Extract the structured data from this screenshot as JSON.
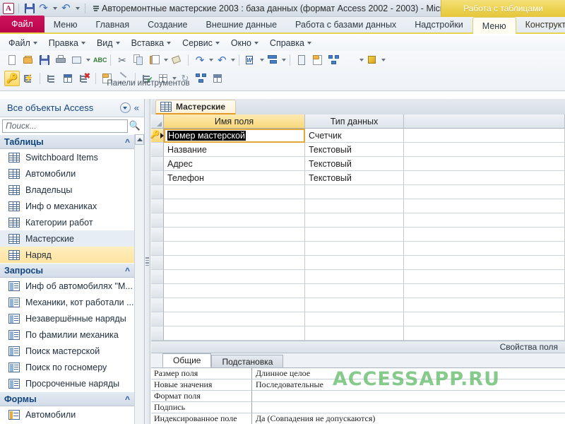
{
  "window": {
    "title": "Авторемонтные мастерские 2003 : база данных (формат Access 2002 - 2003)  -  Microsof...",
    "contextual_banner": "Работа с таблицами"
  },
  "quick_access": {
    "app_icon": "access-logo-icon",
    "buttons": [
      {
        "name": "save-icon",
        "label": "Сохранить"
      },
      {
        "name": "undo-icon",
        "label": "Отменить"
      },
      {
        "name": "redo-icon",
        "label": "Вернуть"
      },
      {
        "name": "customize-qat-icon",
        "label": "Настройка панели быстрого доступа"
      }
    ]
  },
  "ribbon": {
    "tabs": [
      {
        "label": "Файл",
        "kind": "file"
      },
      {
        "label": "Меню",
        "kind": "normal"
      },
      {
        "label": "Главная",
        "kind": "normal"
      },
      {
        "label": "Создание",
        "kind": "normal"
      },
      {
        "label": "Внешние данные",
        "kind": "normal"
      },
      {
        "label": "Работа с базами данных",
        "kind": "normal"
      },
      {
        "label": "Надстройки",
        "kind": "normal"
      },
      {
        "label": "Меню",
        "kind": "ctx-selected"
      },
      {
        "label": "Конструктор",
        "kind": "ctx"
      }
    ]
  },
  "menubar": {
    "items": [
      {
        "label": "Файл"
      },
      {
        "label": "Правка"
      },
      {
        "label": "Вид"
      },
      {
        "label": "Вставка"
      },
      {
        "label": "Сервис"
      },
      {
        "label": "Окно"
      },
      {
        "label": "Справка"
      }
    ]
  },
  "toolbar": {
    "group_label": "Панели инструментов",
    "row1": [
      {
        "name": "new-database-icon"
      },
      {
        "name": "open-icon"
      },
      {
        "name": "save-icon"
      },
      {
        "name": "print-icon"
      },
      {
        "name": "print-preview-icon",
        "caret": true
      },
      {
        "name": "spelling-icon"
      },
      {
        "name": "cut-icon"
      },
      {
        "name": "copy-icon"
      },
      {
        "name": "paste-icon",
        "caret": true
      },
      {
        "name": "format-painter-icon"
      },
      {
        "name": "undo-icon",
        "caret": true
      },
      {
        "name": "redo-icon",
        "caret": true
      },
      {
        "name": "office-links-icon",
        "caret": true
      },
      {
        "name": "analyze-icon",
        "caret": true
      },
      {
        "name": "code-icon"
      },
      {
        "name": "properties-icon"
      },
      {
        "name": "relationships-icon"
      },
      {
        "name": "new-object-icon",
        "caret": true
      },
      {
        "name": "help-icon",
        "caret": true
      }
    ],
    "row2": [
      {
        "name": "primary-key-icon",
        "active": true
      },
      {
        "name": "indexes-icon"
      },
      {
        "name": "insert-rows-icon"
      },
      {
        "name": "lookup-column-icon"
      },
      {
        "name": "delete-rows-icon"
      },
      {
        "name": "property-sheet-icon"
      },
      {
        "name": "build-icon"
      },
      {
        "name": "test-validation-rules-icon"
      },
      {
        "name": "database-objects-icon",
        "caret": true
      },
      {
        "name": "refresh-icon"
      },
      {
        "name": "relationships2-icon"
      },
      {
        "name": "datasheet-view-icon"
      }
    ]
  },
  "navigation": {
    "title": "Все объекты Access",
    "menu_icon": "chevron-down-circle-icon",
    "collapse_icon": "double-chevron-left-icon",
    "search": {
      "placeholder": "Поиск...",
      "value": "",
      "icon": "search-icon"
    },
    "groups": [
      {
        "label": "Таблицы",
        "icon_type": "table",
        "items": [
          {
            "label": "Switchboard Items",
            "state": "normal"
          },
          {
            "label": "Автомобили",
            "state": "normal"
          },
          {
            "label": "Владельцы",
            "state": "normal"
          },
          {
            "label": "Инф о механиках",
            "state": "normal"
          },
          {
            "label": "Категории работ",
            "state": "normal"
          },
          {
            "label": "Мастерские",
            "state": "hover"
          },
          {
            "label": "Наряд",
            "state": "selected"
          }
        ]
      },
      {
        "label": "Запросы",
        "icon_type": "query",
        "items": [
          {
            "label": "Инф об автомобилях \"М...",
            "state": "normal"
          },
          {
            "label": "Механики, кот работали ...",
            "state": "normal"
          },
          {
            "label": "Незавершённые наряды",
            "state": "normal"
          },
          {
            "label": "По фамилии механика",
            "state": "normal"
          },
          {
            "label": "Поиск мастерской",
            "state": "normal"
          },
          {
            "label": "Поиск по госномеру",
            "state": "normal"
          },
          {
            "label": "Просроченные наряды",
            "state": "normal"
          }
        ]
      },
      {
        "label": "Формы",
        "icon_type": "form",
        "items": [
          {
            "label": "Автомобили",
            "state": "normal"
          }
        ]
      }
    ]
  },
  "document": {
    "tab": {
      "label": "Мастерские",
      "icon": "table-icon"
    },
    "grid": {
      "columns": [
        "Имя поля",
        "Тип данных",
        ""
      ],
      "rows": [
        {
          "field_name": "Номер мастерской",
          "data_type": "Счетчик",
          "description": "",
          "primary_key": true,
          "selected": true
        },
        {
          "field_name": "Название",
          "data_type": "Текстовый",
          "description": "",
          "primary_key": false,
          "selected": false
        },
        {
          "field_name": "Адрес",
          "data_type": "Текстовый",
          "description": "",
          "primary_key": false,
          "selected": false
        },
        {
          "field_name": "Телефон",
          "data_type": "Текстовый",
          "description": "",
          "primary_key": false,
          "selected": false
        }
      ],
      "empty_row_count": 13
    },
    "properties": {
      "title": "Свойства поля",
      "tabs": [
        {
          "label": "Общие",
          "active": true
        },
        {
          "label": "Подстановка",
          "active": false
        }
      ],
      "rows": [
        {
          "name": "Размер поля",
          "value": "Длинное целое"
        },
        {
          "name": "Новые значения",
          "value": "Последовательные"
        },
        {
          "name": "Формат поля",
          "value": ""
        },
        {
          "name": "Подпись",
          "value": ""
        },
        {
          "name": "Индексированное поле",
          "value": "Да (Совпадения не допускаются)"
        }
      ]
    }
  },
  "watermark": {
    "text": "ACCESSAPP.RU"
  },
  "colors": {
    "file_tab": "#c2125a",
    "contextual_yellow": "#ecd14f",
    "accent_orange": "#e39b28",
    "nav_header_text": "#13457e",
    "watermark_green": "#3caa46"
  }
}
